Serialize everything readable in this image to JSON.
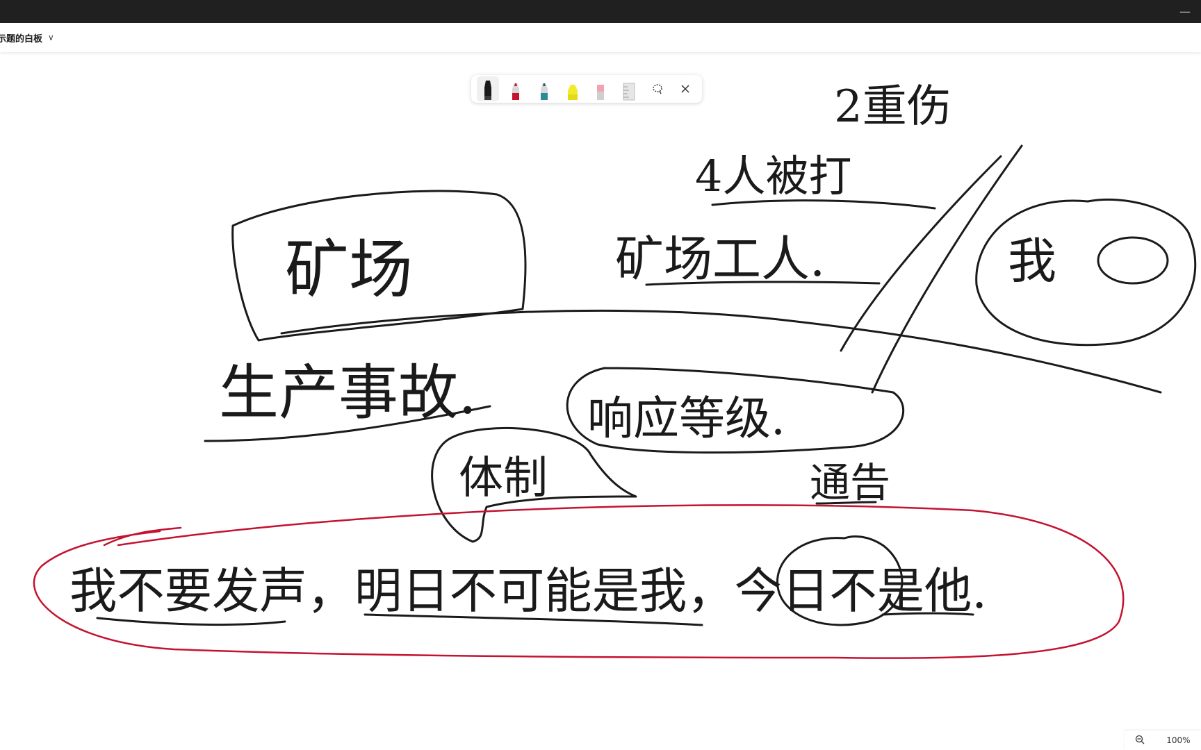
{
  "header": {
    "board_title": "示题的白板"
  },
  "toolbar": {
    "tools": [
      {
        "name": "black-pen",
        "color": "#1a1a1a"
      },
      {
        "name": "red-pen",
        "color": "#c4122f"
      },
      {
        "name": "teal-pen",
        "color": "#2d8a9a"
      },
      {
        "name": "yellow-highlighter",
        "color": "#f2ea2a"
      },
      {
        "name": "eraser",
        "color": "#f2a3b0"
      },
      {
        "name": "ruler",
        "color": "#c9c9c9"
      }
    ]
  },
  "zoom": {
    "level": "100%"
  },
  "colors": {
    "ink": "#1a1a1a",
    "red_ink": "#c4122f",
    "titlebar": "#202020"
  },
  "ink_text": {
    "heavy_injury": "2重伤",
    "four_beaten": "4人被打",
    "mine": "矿场",
    "mine_workers": "矿场工人.",
    "me": "我",
    "accident": "生产事故.",
    "response_level": "响应等级.",
    "body": "体制",
    "notice": "通告",
    "statement": "我不要发声，明日不可能是我，今日不是他."
  }
}
